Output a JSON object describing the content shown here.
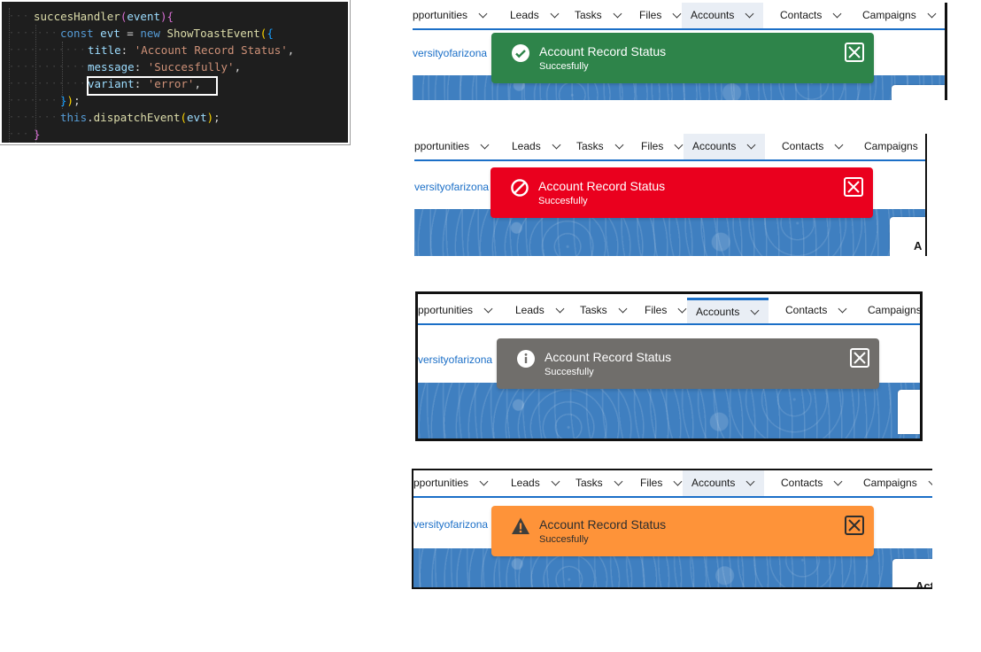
{
  "code": {
    "lines": [
      {
        "parts": [
          [
            "fn",
            "succesHandler"
          ],
          [
            "brk1",
            "("
          ],
          [
            "prop",
            "event"
          ],
          [
            "brk1",
            ")"
          ],
          [
            "brk1",
            "{"
          ]
        ]
      },
      {
        "parts": [
          [
            "kw",
            "const"
          ],
          [
            "pun",
            " "
          ],
          [
            "prop",
            "evt"
          ],
          [
            "pun",
            " = "
          ],
          [
            "kw",
            "new"
          ],
          [
            "pun",
            " "
          ],
          [
            "fn",
            "ShowToastEvent"
          ],
          [
            "brk2",
            "("
          ],
          [
            "brk3",
            "{"
          ]
        ]
      },
      {
        "parts": [
          [
            "prop",
            "title"
          ],
          [
            "pun",
            ": "
          ],
          [
            "str",
            "'Account Record Status'"
          ],
          [
            "pun",
            ","
          ]
        ]
      },
      {
        "parts": [
          [
            "prop",
            "message"
          ],
          [
            "pun",
            ": "
          ],
          [
            "str",
            "'Succesfully'"
          ],
          [
            "pun",
            ","
          ]
        ]
      },
      {
        "parts": [
          [
            "prop",
            "variant"
          ],
          [
            "pun",
            ": "
          ],
          [
            "str",
            "'error'"
          ],
          [
            "pun",
            ","
          ]
        ]
      },
      {
        "parts": [
          [
            "brk3",
            "}"
          ],
          [
            "brk2",
            ")"
          ],
          [
            "pun",
            ";"
          ]
        ]
      },
      {
        "parts": [
          [
            "kw",
            "this"
          ],
          [
            "pun",
            "."
          ],
          [
            "fn",
            "dispatchEvent"
          ],
          [
            "brk2",
            "("
          ],
          [
            "prop",
            "evt"
          ],
          [
            "brk2",
            ")"
          ],
          [
            "pun",
            ";"
          ]
        ]
      },
      {
        "parts": [
          [
            "brk1",
            "}"
          ]
        ]
      }
    ]
  },
  "nav": {
    "items": [
      "pportunities",
      "Leads",
      "Tasks",
      "Files",
      "Accounts",
      "Contacts",
      "Campaigns"
    ],
    "active": "Accounts"
  },
  "account_link": "versityofarizona",
  "toasts": [
    {
      "variant": "success",
      "title": "Account Record Status",
      "message": "Succesfully",
      "color": "#2e844a",
      "icon": "check-circle-icon",
      "card_text": ""
    },
    {
      "variant": "error",
      "title": "Account Record Status",
      "message": "Succesfully",
      "color": "#ea001e",
      "icon": "ban-icon",
      "card_text": "A"
    },
    {
      "variant": "info",
      "title": "Account Record Status",
      "message": "Succesfully",
      "color": "#706e6b",
      "icon": "info-icon",
      "card_text": ""
    },
    {
      "variant": "warning",
      "title": "Account Record Status",
      "message": "Succesfully",
      "color": "#fe9339",
      "icon": "warning-icon",
      "card_text": "Act"
    }
  ]
}
